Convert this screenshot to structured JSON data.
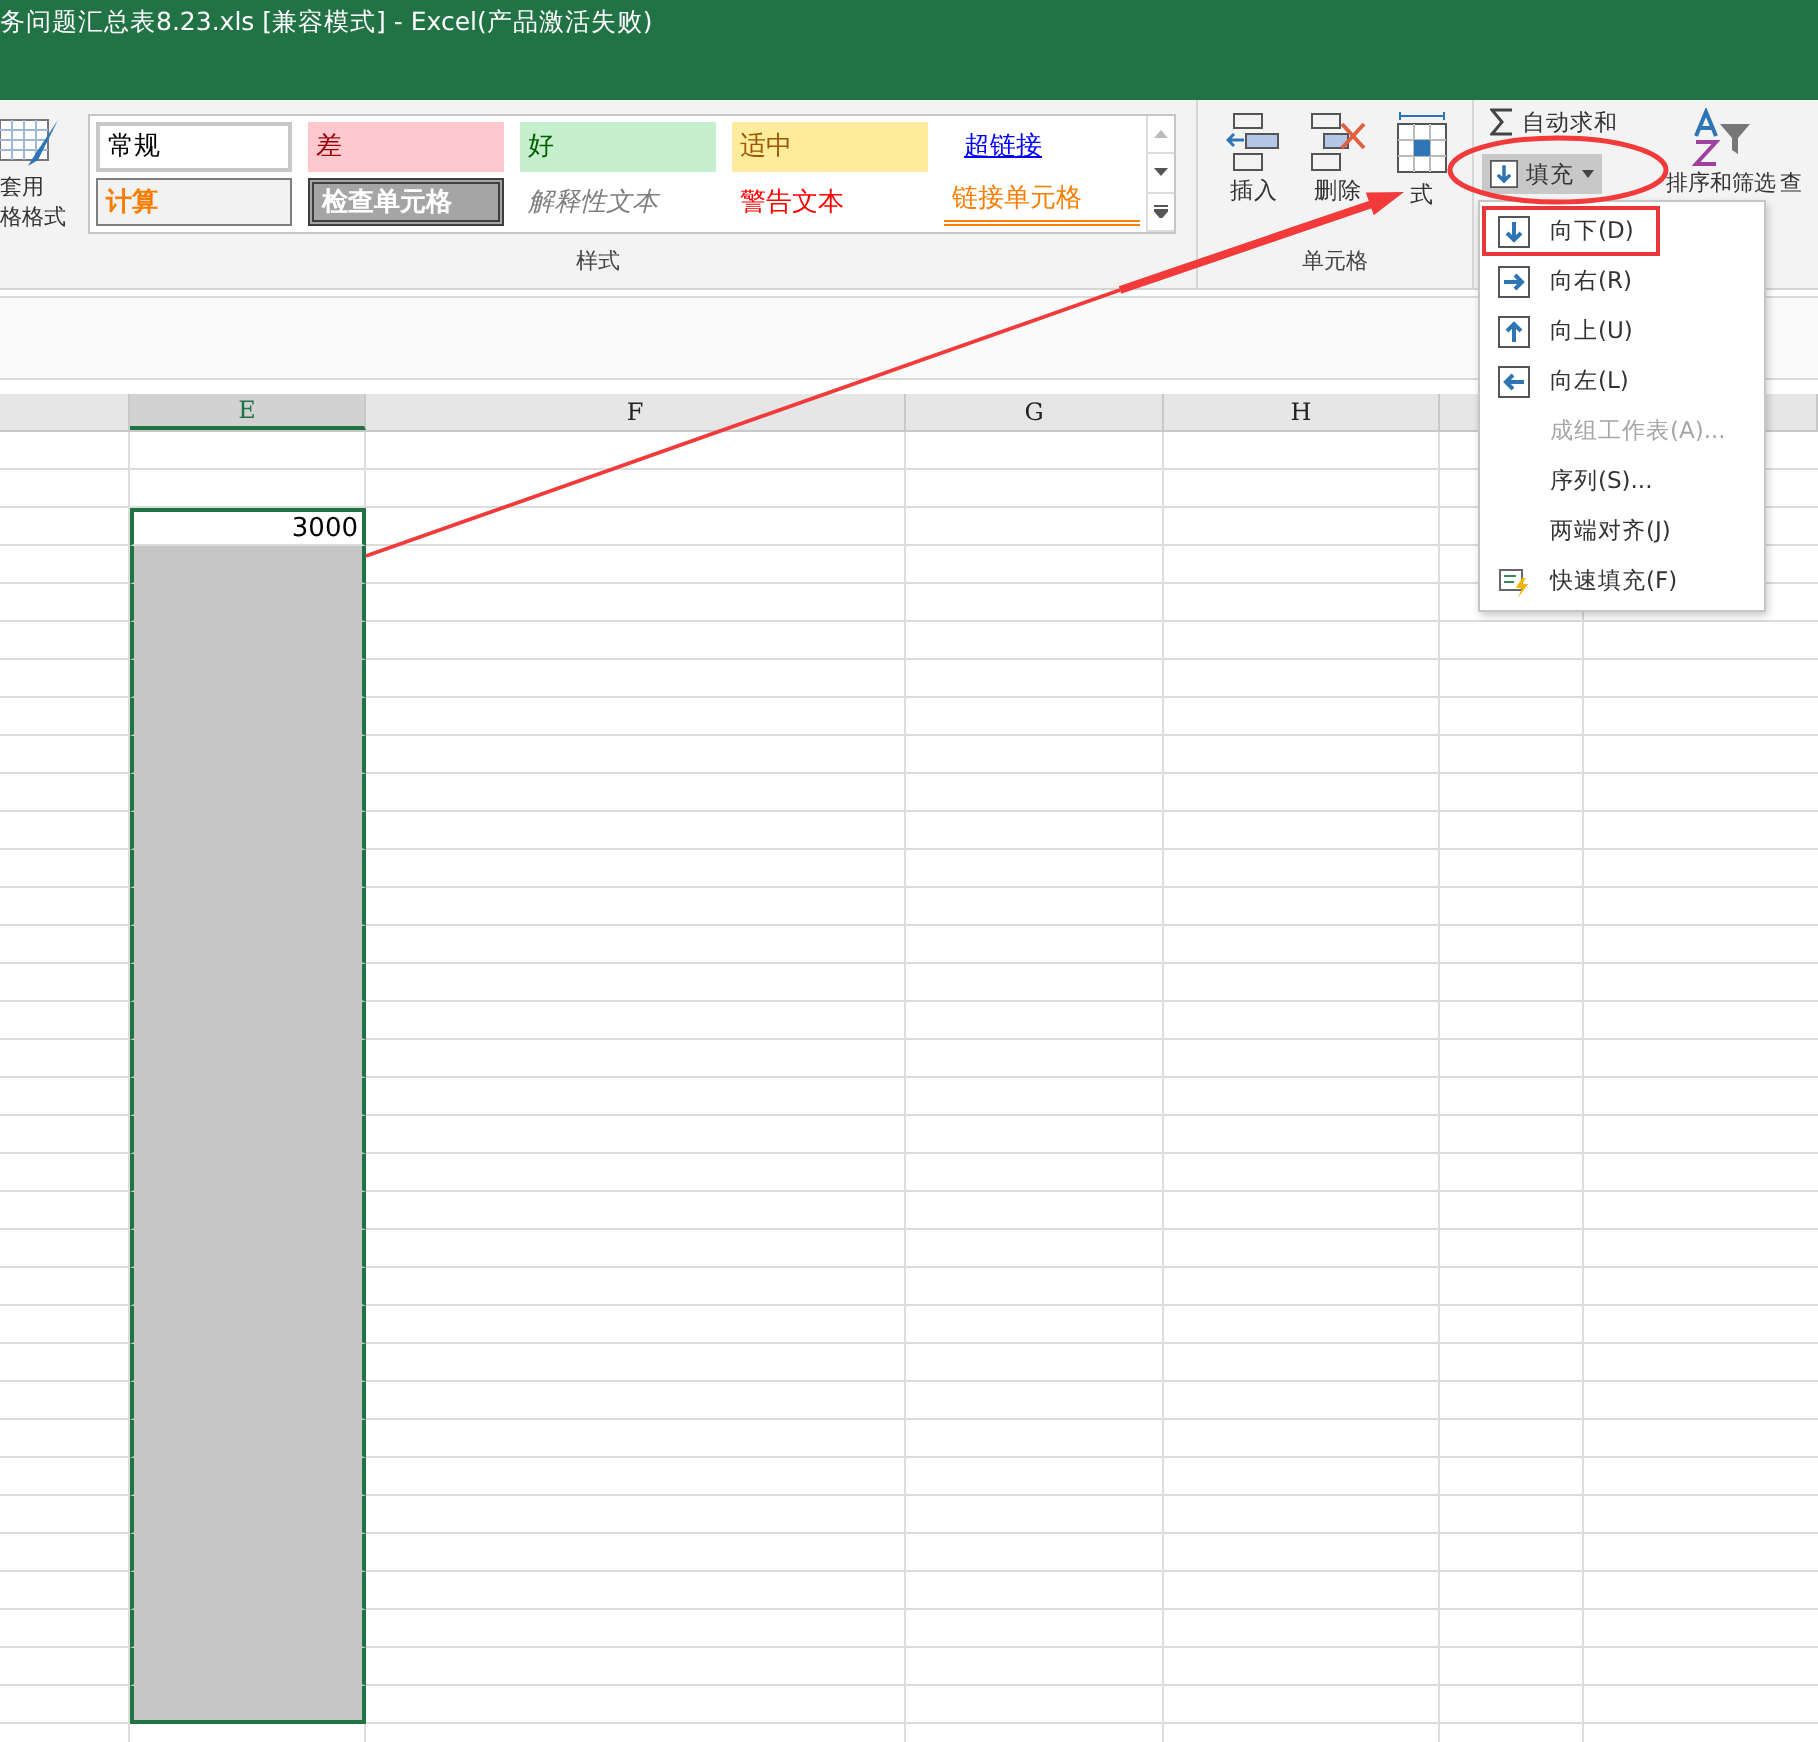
{
  "window": {
    "title": "务问题汇总表8.23.xls  [兼容模式] - Excel(产品激活失败)"
  },
  "ribbon": {
    "table_format": {
      "lines": [
        "套用",
        "格格式"
      ]
    },
    "styles": [
      {
        "kind": "normal",
        "label": "常规"
      },
      {
        "kind": "bad",
        "label": "差"
      },
      {
        "kind": "good",
        "label": "好"
      },
      {
        "kind": "neutral",
        "label": "适中"
      },
      {
        "kind": "hyperlink",
        "label": "超链接"
      },
      {
        "kind": "calc",
        "label": "计算"
      },
      {
        "kind": "check",
        "label": "检查单元格"
      },
      {
        "kind": "explanatory",
        "label": "解释性文本"
      },
      {
        "kind": "warning",
        "label": "警告文本"
      },
      {
        "kind": "linked",
        "label": "链接单元格"
      }
    ],
    "styles_group": "样式",
    "cells_buttons": [
      {
        "kind": "insert",
        "label": "插入"
      },
      {
        "kind": "delete",
        "label": "删除"
      },
      {
        "kind": "format",
        "label": "式"
      }
    ],
    "cells_group": "单元格",
    "autosum": "自动求和",
    "fill": {
      "label": "填充",
      "pressed": true
    },
    "sort": "排序和筛选",
    "find": "查"
  },
  "fill_menu": [
    {
      "kind": "down",
      "label": "向下(D)",
      "disabled": false,
      "selected": true
    },
    {
      "kind": "right",
      "label": "向右(R)",
      "disabled": false,
      "selected": false
    },
    {
      "kind": "up",
      "label": "向上(U)",
      "disabled": false,
      "selected": false
    },
    {
      "kind": "left",
      "label": "向左(L)",
      "disabled": false,
      "selected": false
    },
    {
      "kind": "plain",
      "label": "成组工作表(A)...",
      "disabled": true,
      "selected": false
    },
    {
      "kind": "plain",
      "label": "序列(S)...",
      "disabled": false,
      "selected": false
    },
    {
      "kind": "plain",
      "label": "两端对齐(J)",
      "disabled": false,
      "selected": false
    },
    {
      "kind": "flash",
      "label": "快速填充(F)",
      "disabled": false,
      "selected": false
    }
  ],
  "sheet": {
    "columns": [
      {
        "label": "E",
        "selected": true
      },
      {
        "label": "F",
        "selected": false
      },
      {
        "label": "G",
        "selected": false
      },
      {
        "label": "H",
        "selected": false
      }
    ],
    "column_E": [
      {
        "selected": false
      },
      {
        "selected": false
      },
      {
        "value": "3000",
        "selected": true
      },
      {
        "selected": true
      },
      {
        "selected": true
      },
      {
        "selected": true
      },
      {
        "selected": true
      },
      {
        "selected": true
      },
      {
        "selected": true
      },
      {
        "selected": true
      },
      {
        "selected": true
      },
      {
        "selected": true
      },
      {
        "selected": true
      },
      {
        "selected": true
      },
      {
        "selected": true
      },
      {
        "selected": true
      },
      {
        "selected": true
      },
      {
        "selected": true
      },
      {
        "selected": true
      },
      {
        "selected": true
      },
      {
        "selected": true
      },
      {
        "selected": true
      },
      {
        "selected": true
      },
      {
        "selected": true
      },
      {
        "selected": true
      },
      {
        "selected": true
      },
      {
        "selected": true
      },
      {
        "selected": true
      },
      {
        "selected": true
      },
      {
        "selected": true
      },
      {
        "selected": true
      },
      {
        "selected": true
      },
      {
        "selected": true
      },
      {
        "selected": true
      },
      {
        "selected": false
      }
    ]
  }
}
